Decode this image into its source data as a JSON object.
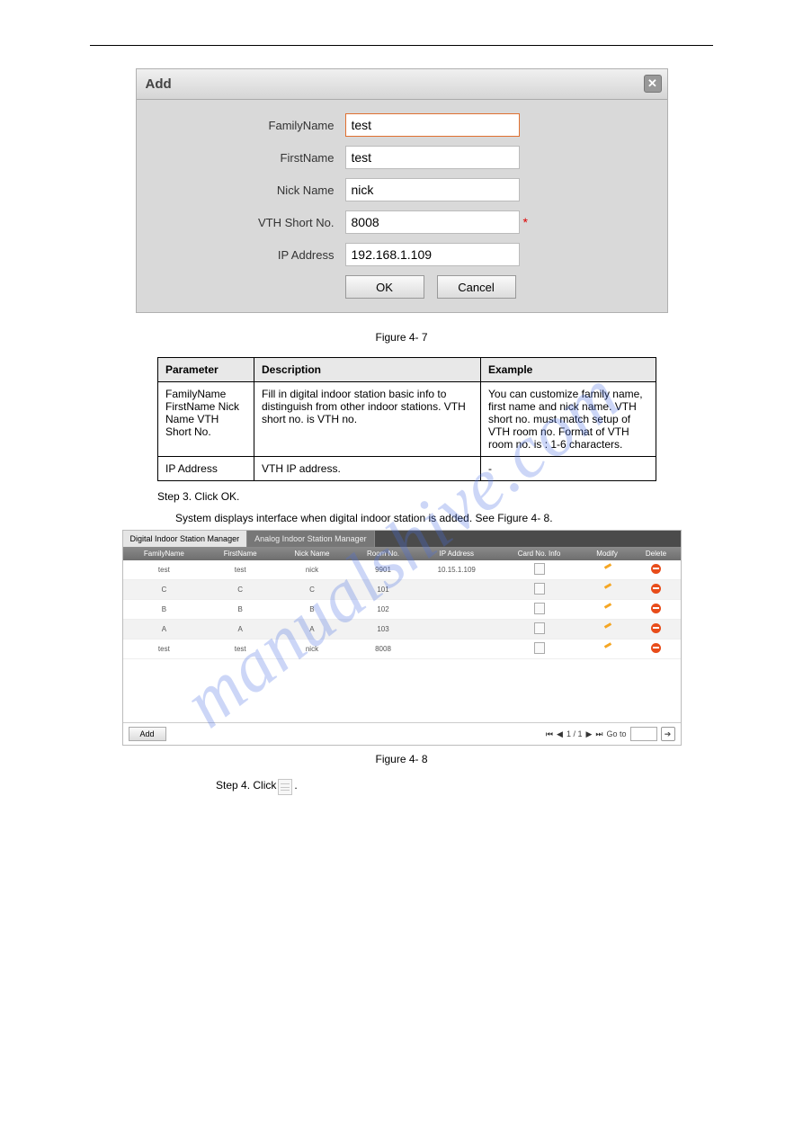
{
  "watermark": "manualshive.com",
  "dialog": {
    "title": "Add",
    "fields": {
      "familyName": {
        "label": "FamilyName",
        "value": "test"
      },
      "firstName": {
        "label": "FirstName",
        "value": "test"
      },
      "nickName": {
        "label": "Nick Name",
        "value": "nick"
      },
      "vthShort": {
        "label": "VTH Short No.",
        "value": "8008",
        "marker": "*"
      },
      "ipAddress": {
        "label": "IP Address",
        "value": "192.168.1.109"
      }
    },
    "buttons": {
      "ok": "OK",
      "cancel": "Cancel"
    }
  },
  "captions": {
    "figure7": "Figure 4- 7",
    "figure8": "Figure 4- 8"
  },
  "paramTable": {
    "headers": [
      "Parameter",
      "Description",
      "Example"
    ],
    "rows": [
      {
        "param": "FamilyName\nFirstName\nNick Name\nVTH Short No.",
        "desc": "Fill in digital indoor station basic info to distinguish from other indoor stations. VTH short no. is VTH no.",
        "example": "You can customize family name, first name and nick name.\nVTH short no. must match setup of VTH room no.\nFormat of VTH room no. is : 1-6 characters."
      },
      {
        "param": "IP Address",
        "desc": "VTH IP address.",
        "example": "-"
      }
    ]
  },
  "body": {
    "step3": "Step 3. Click OK.",
    "step3note": "System displays interface when digital indoor station is added. See Figure 4- 8.",
    "cardPrefix": "Step 4. Click ",
    "cardSuffix": "."
  },
  "panel": {
    "tabs": [
      "Digital Indoor Station Manager",
      "Analog Indoor Station Manager"
    ],
    "columns": [
      "FamilyName",
      "FirstName",
      "Nick Name",
      "Room No.",
      "IP Address",
      "Card No. Info",
      "Modify",
      "Delete"
    ],
    "rows": [
      {
        "family": "test",
        "first": "test",
        "nick": "nick",
        "room": "9901",
        "ip": "10.15.1.109"
      },
      {
        "family": "C",
        "first": "C",
        "nick": "C",
        "room": "101",
        "ip": ""
      },
      {
        "family": "B",
        "first": "B",
        "nick": "B",
        "room": "102",
        "ip": ""
      },
      {
        "family": "A",
        "first": "A",
        "nick": "A",
        "room": "103",
        "ip": ""
      },
      {
        "family": "test",
        "first": "test",
        "nick": "nick",
        "room": "8008",
        "ip": ""
      }
    ],
    "addLabel": "Add",
    "pager": {
      "status": "1 / 1",
      "gotoLabel": "Go to"
    }
  }
}
